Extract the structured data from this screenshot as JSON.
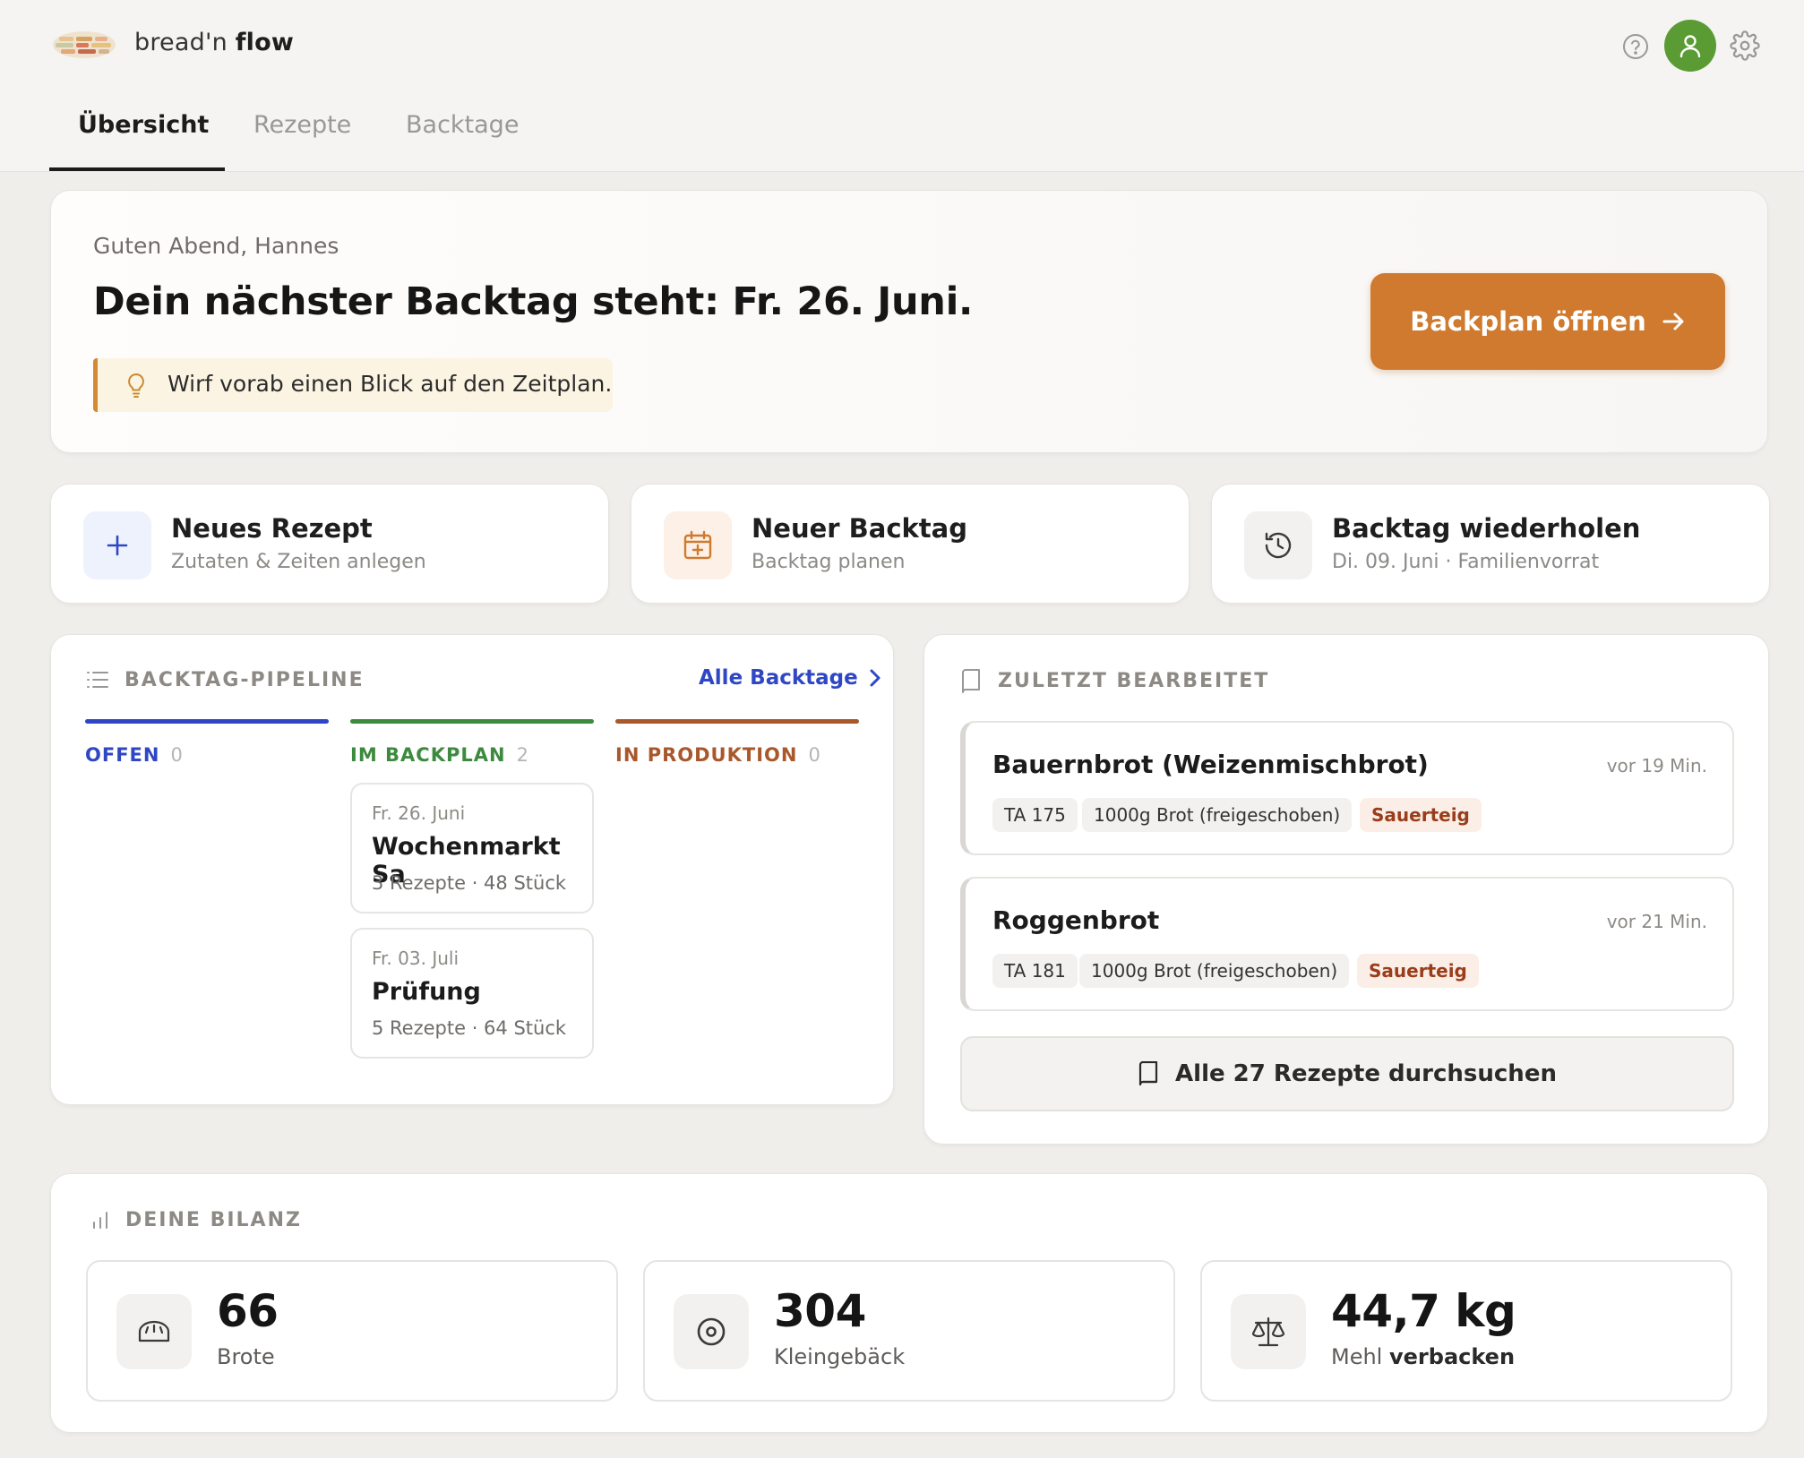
{
  "app": {
    "name_part1": "bread'n",
    "name_part2": "flow"
  },
  "nav": {
    "tabs": [
      {
        "label": "Übersicht",
        "active": true
      },
      {
        "label": "Rezepte",
        "active": false
      },
      {
        "label": "Backtage",
        "active": false
      }
    ]
  },
  "hero": {
    "greeting": "Guten Abend, Hannes",
    "title": "Dein nächster Backtag steht: Fr. 26. Juni.",
    "tip": "Wirf vorab einen Blick auf den Zeitplan.",
    "cta_label": "Backplan öffnen"
  },
  "quick_actions": [
    {
      "title": "Neues Rezept",
      "subtitle": "Zutaten & Zeiten anlegen",
      "icon": "plus-icon"
    },
    {
      "title": "Neuer Backtag",
      "subtitle": "Backtag planen",
      "icon": "calendar-plus-icon"
    },
    {
      "title": "Backtag wiederholen",
      "subtitle": "Di. 09. Juni · Familienvorrat",
      "icon": "history-icon"
    }
  ],
  "pipeline": {
    "label": "BACKTAG-PIPELINE",
    "all_link": "Alle Backtage",
    "columns": [
      {
        "title": "OFFEN",
        "count": "0",
        "color": "#2f47c4"
      },
      {
        "title": "IM BACKPLAN",
        "count": "2",
        "color": "#3d8a3f"
      },
      {
        "title": "IN PRODUKTION",
        "count": "0",
        "color": "#a9582b"
      }
    ],
    "cards": [
      {
        "date": "Fr. 26. Juni",
        "name": "Wochenmarkt Sa",
        "meta": "3 Rezepte · 48 Stück"
      },
      {
        "date": "Fr. 03. Juli",
        "name": "Prüfung",
        "meta": "5 Rezepte · 64 Stück"
      }
    ]
  },
  "recent": {
    "label": "ZULETZT BEARBEITET",
    "items": [
      {
        "name": "Bauernbrot (Weizenmischbrot)",
        "time": "vor 19 Min.",
        "tags": [
          "TA 175",
          "1000g Brot (freigeschoben)",
          "Sauerteig"
        ]
      },
      {
        "name": "Roggenbrot",
        "time": "vor 21 Min.",
        "tags": [
          "TA 181",
          "1000g Brot (freigeschoben)",
          "Sauerteig"
        ]
      }
    ],
    "browse_label": "Alle 27 Rezepte durchsuchen"
  },
  "bilanz": {
    "label": "DEINE BILANZ",
    "stats": [
      {
        "value": "66",
        "label": "Brote",
        "icon": "bread-icon"
      },
      {
        "value": "304",
        "label": "Kleingebäck",
        "icon": "roll-icon"
      },
      {
        "value": "44,7 kg",
        "label_pre": "Mehl",
        "label_bold": "verbacken",
        "icon": "scale-icon"
      }
    ]
  },
  "colors": {
    "accent": "#cf7a2e",
    "avatar": "#5b9b34",
    "link": "#2f47c4",
    "background": "#efeeeb"
  }
}
